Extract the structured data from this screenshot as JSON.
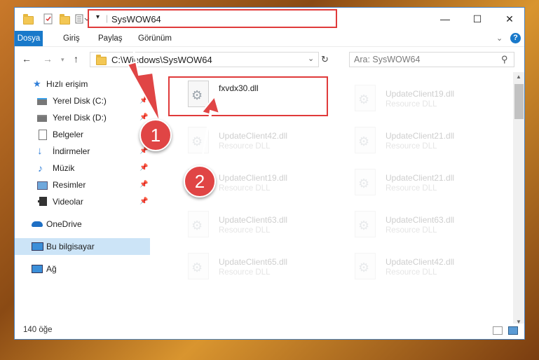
{
  "window": {
    "title": "SysWOW64",
    "controls": {
      "minimize": "—",
      "maximize": "☐",
      "close": "✕"
    }
  },
  "ribbon": {
    "tabs": [
      "Dosya",
      "Giriş",
      "Paylaş",
      "Görünüm"
    ],
    "help": "?"
  },
  "navbar": {
    "address": "C:\\Windows\\SysWOW64",
    "search_placeholder": "Ara: SysWOW64"
  },
  "sidebar": {
    "items": [
      {
        "label": "Hızlı erişim",
        "icon": "star-icon",
        "pinned": false
      },
      {
        "label": "Yerel Disk (C:)",
        "icon": "drive-icon",
        "pinned": true
      },
      {
        "label": "Yerel Disk (D:)",
        "icon": "drive-icon",
        "pinned": true
      },
      {
        "label": "Belgeler",
        "icon": "documents-icon",
        "pinned": true
      },
      {
        "label": "İndirmeler",
        "icon": "download-icon",
        "pinned": true
      },
      {
        "label": "Müzik",
        "icon": "music-icon",
        "pinned": true
      },
      {
        "label": "Resimler",
        "icon": "pictures-icon",
        "pinned": true
      },
      {
        "label": "Videolar",
        "icon": "videos-icon",
        "pinned": true
      },
      {
        "label": "OneDrive",
        "icon": "cloud-icon",
        "pinned": false
      },
      {
        "label": "Bu bilgisayar",
        "icon": "computer-icon",
        "pinned": false,
        "selected": true
      },
      {
        "label": "Ağ",
        "icon": "network-icon",
        "pinned": false
      }
    ]
  },
  "files": {
    "main": {
      "name": "fxvdx30.dll",
      "type": ""
    },
    "ghost": [
      {
        "name": "UpdateClient42.dll",
        "type": "Resource DLL"
      },
      {
        "name": "UpdateClient19.dll",
        "type": "Resource DLL"
      },
      {
        "name": "UpdateClient63.dll",
        "type": "Resource DLL"
      },
      {
        "name": "UpdateClient65.dll",
        "type": "Resource DLL"
      },
      {
        "name": "UpdateClient19.dll",
        "type": "Resource DLL"
      },
      {
        "name": "UpdateClient21.dll",
        "type": "Resource DLL"
      },
      {
        "name": "UpdateClient21.dll",
        "type": "Resource DLL"
      },
      {
        "name": "UpdateClient63.dll",
        "type": "Resource DLL"
      },
      {
        "name": "UpdateClient42.dll",
        "type": "Resource DLL"
      }
    ]
  },
  "status": {
    "count": "140 öğe"
  },
  "annotations": {
    "step1": "1",
    "step2": "2",
    "accent": "#e04545"
  }
}
